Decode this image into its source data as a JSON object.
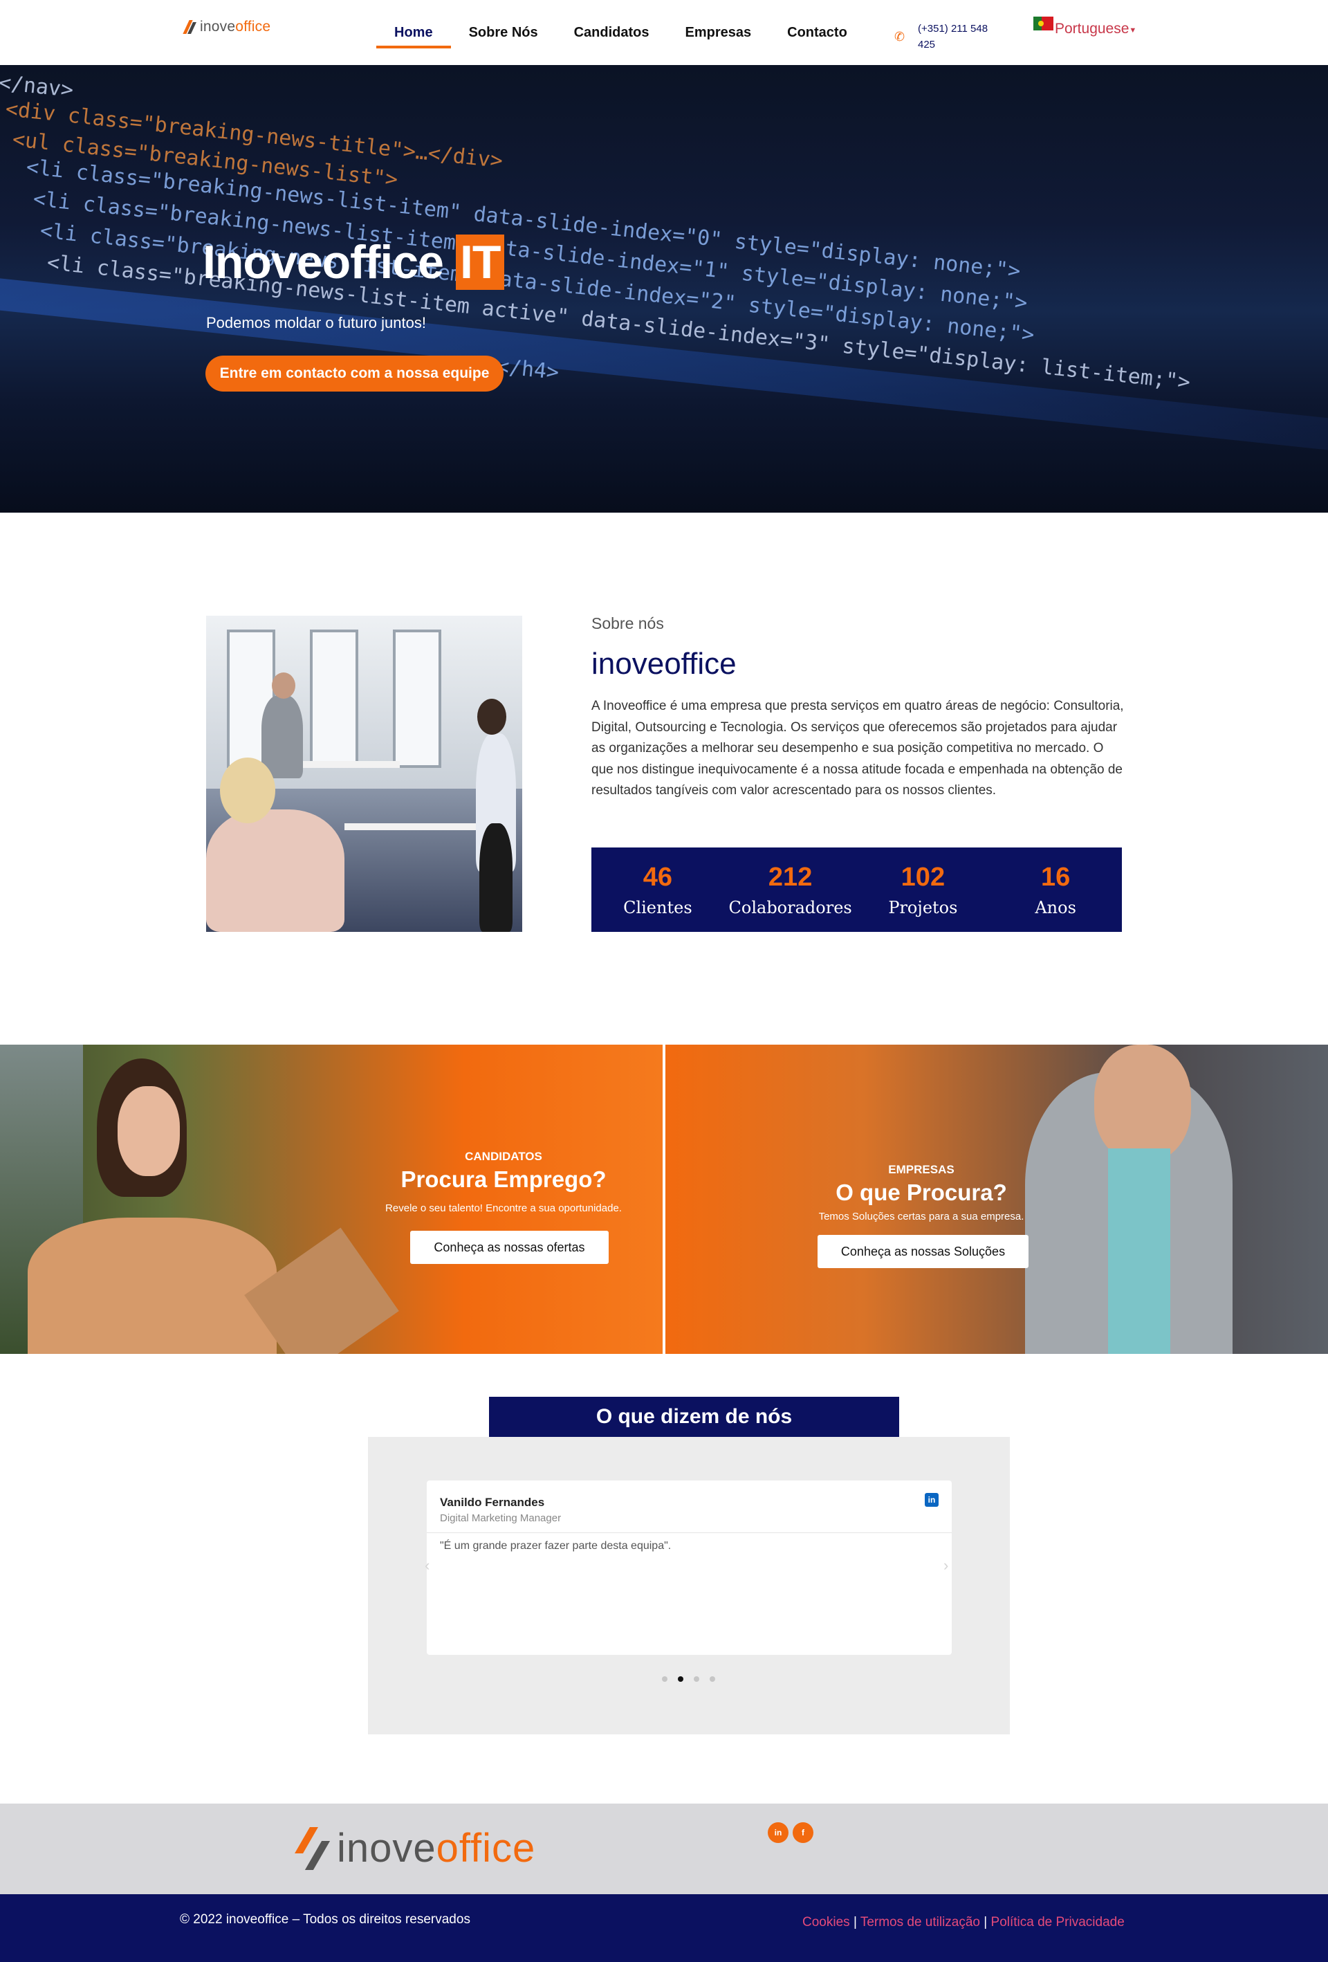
{
  "header": {
    "logo": {
      "part1": "inove",
      "part2": "office"
    },
    "nav": [
      {
        "label": "Home",
        "active": true
      },
      {
        "label": "Sobre Nós"
      },
      {
        "label": "Candidatos"
      },
      {
        "label": "Empresas"
      },
      {
        "label": "Contacto"
      }
    ],
    "phone": {
      "icon": "phone-icon",
      "text": "(+351) 211 548 425"
    },
    "language": {
      "flag": "portugal-flag-icon",
      "label": "Portuguese"
    }
  },
  "hero": {
    "title": "Inoveoffice",
    "title_highlight": "IT",
    "subtitle": "Podemos moldar o futuro juntos!",
    "cta": "Entre em contacto com a nossa equipe",
    "code_lines": [
      "</nav>",
      "<div class=\"breaking-news-title\">…</div>",
      "<ul class=\"breaking-news-list\">",
      "<li class=\"breaking-news-list-item\" data-slide-index=\"0\" style=\"display: none;\">",
      "<li class=\"breaking-news-list-item\" data-slide-index=\"1\" style=\"display: none;\">",
      "<li class=\"breaking-news-list-item\" data-slide-index=\"2\" style=\"display: none;\">",
      "<li class=\"breaking-news-list-item active\" data-slide-index=\"3\" style=\"display: list-item;\">",
      "</h4>"
    ]
  },
  "about": {
    "subtitle": "Sobre nós",
    "title": "inoveoffice",
    "text": "A Inoveoffice é uma empresa que presta serviços em quatro áreas de negócio: Consultoria, Digital, Outsourcing e Tecnologia. Os serviços que oferecemos são projetados para ajudar as organizações a melhorar seu desempenho e sua posição competitiva no mercado. O que nos distingue inequivocamente é a nossa atitude focada e empenhada na obtenção de resultados tangíveis com valor acrescentado para os nossos clientes.",
    "stats": [
      {
        "value": "46",
        "label": "Clientes"
      },
      {
        "value": "212",
        "label": "Colaboradores"
      },
      {
        "value": "102",
        "label": "Projetos"
      },
      {
        "value": "16",
        "label": "Anos"
      }
    ]
  },
  "promos": {
    "candidatos": {
      "kicker": "CANDIDATOS",
      "headline": "Procura Emprego?",
      "tagline": "Revele o seu talento! Encontre a sua oportunidade.",
      "button": "Conheça as nossas ofertas"
    },
    "empresas": {
      "kicker": "EMPRESAS",
      "headline": "O que Procura?",
      "tagline": "Temos Soluções certas para a sua empresa.",
      "button": "Conheça as nossas Soluções"
    }
  },
  "testimonials": {
    "title": "O que dizem de nós",
    "active_index": 1,
    "item": {
      "name": "Vanildo Fernandes",
      "role": "Digital Marketing Manager",
      "quote": "\"É um grande prazer fazer parte desta equipa\".",
      "social": "in"
    },
    "prev": "‹",
    "next": "›"
  },
  "footer": {
    "logo": {
      "part1": "inove",
      "part2": "office"
    },
    "socials": [
      {
        "icon": "linkedin-icon",
        "glyph": "in"
      },
      {
        "icon": "facebook-icon",
        "glyph": "f"
      }
    ],
    "copyright": "© 2022 inoveoffice – Todos os direitos reservados",
    "links": [
      "Cookies",
      "Termos de utilização",
      "Política de Privacidade"
    ],
    "separator": "|"
  },
  "colors": {
    "brand_orange": "#f26a0f",
    "brand_navy": "#0b1160",
    "link_pink": "#e54b7a"
  }
}
